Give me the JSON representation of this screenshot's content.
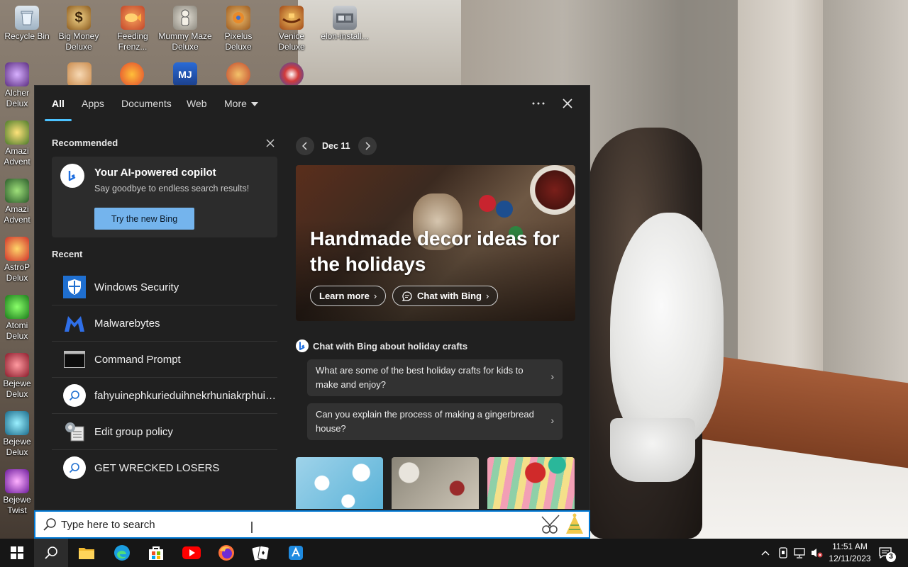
{
  "desktop": {
    "icons": [
      {
        "label": "Recycle Bin"
      },
      {
        "label": "Big Money Deluxe"
      },
      {
        "label": "Feeding Frenz..."
      },
      {
        "label": "Mummy Maze Deluxe"
      },
      {
        "label": "Pixelus Deluxe"
      },
      {
        "label": "Venice Deluxe"
      },
      {
        "label": "elon-install..."
      },
      {
        "label": "Alcher Delux"
      },
      {
        "label": "Amazi Advent"
      },
      {
        "label": "Amazi Advent"
      },
      {
        "label": "AstroP Delux"
      },
      {
        "label": "Atomi Delux"
      },
      {
        "label": "Bejewe Delux"
      },
      {
        "label": "Bejewe Delux"
      },
      {
        "label": "Bejewe Twist"
      }
    ]
  },
  "search_panel": {
    "tabs": [
      {
        "label": "All",
        "active": true
      },
      {
        "label": "Apps"
      },
      {
        "label": "Documents"
      },
      {
        "label": "Web"
      },
      {
        "label": "More"
      }
    ],
    "recommended": {
      "title": "Recommended",
      "card_title": "Your AI-powered copilot",
      "card_subtitle": "Say goodbye to endless search results!",
      "button_label": "Try the new Bing"
    },
    "recent": {
      "title": "Recent",
      "items": [
        {
          "label": "Windows Security",
          "icon": "shield-icon"
        },
        {
          "label": "Malwarebytes",
          "icon": "malwarebytes-icon"
        },
        {
          "label": "Command Prompt",
          "icon": "cmd-icon"
        },
        {
          "label": "fahyuinephkurieduihnekrhuniakrphuiqwe",
          "icon": "search-icon"
        },
        {
          "label": "Edit group policy",
          "icon": "policy-icon"
        },
        {
          "label": "GET WRECKED LOSERS",
          "icon": "search-icon"
        }
      ]
    },
    "highlights": {
      "date": "Dec 11",
      "hero_title": "Handmade decor ideas for the holidays",
      "learn_more": "Learn more",
      "chat_with_bing": "Chat with Bing",
      "chat_heading": "Chat with Bing about holiday crafts",
      "questions": [
        "What are some of the best holiday crafts for kids to make and enjoy?",
        "Can you explain the process of making a gingerbread house?"
      ]
    }
  },
  "search_box": {
    "placeholder": "Type here to search"
  },
  "taskbar": {
    "apps": [
      "start-icon",
      "search-icon",
      "file-explorer-icon",
      "edge-icon",
      "store-icon",
      "youtube-icon",
      "firefox-icon",
      "solitaire-icon",
      "app-icon"
    ],
    "time": "11:51 AM",
    "date": "12/11/2023",
    "notification_count": "3"
  },
  "colors": {
    "accent": "#4cc2ff",
    "bing_button": "#74b4ed",
    "panel_bg": "#202020",
    "taskbar_bg": "#161616"
  }
}
